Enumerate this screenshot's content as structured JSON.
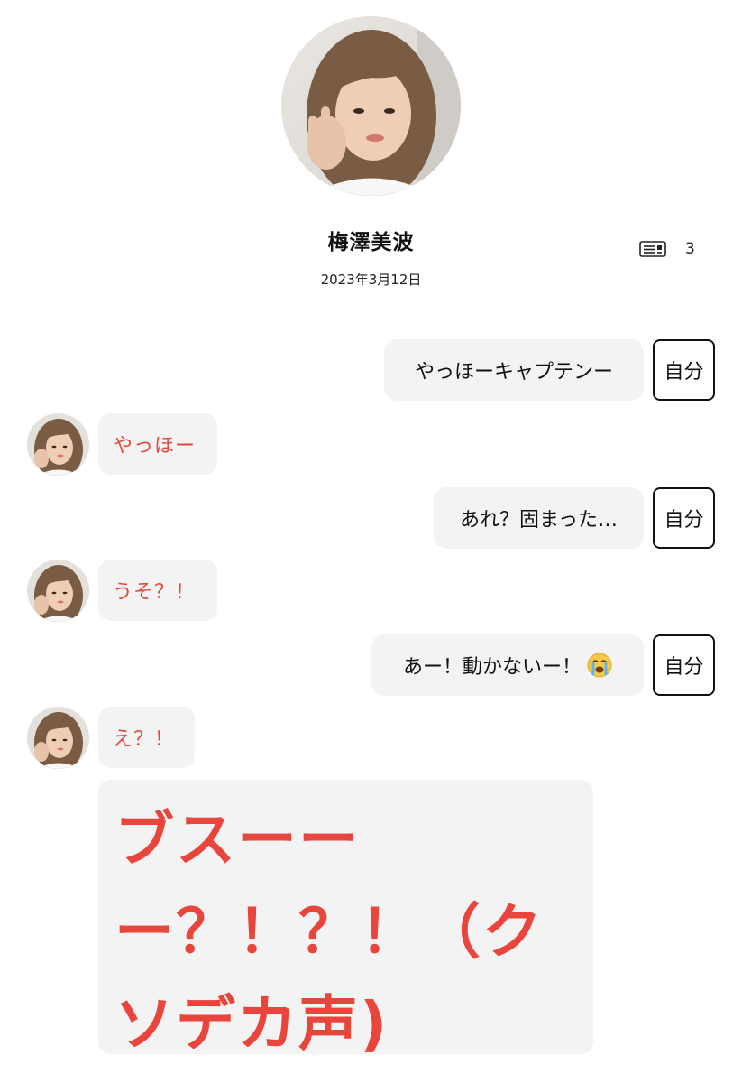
{
  "header": {
    "member_name": "梅澤美波",
    "date": "2023年3月12日",
    "letter_icon": "letter-list-icon",
    "letter_count": "3"
  },
  "messages": [
    {
      "sender": "self",
      "text": "やっほーキャプテンー",
      "tag": "自分"
    },
    {
      "sender": "member",
      "text": "やっほー"
    },
    {
      "sender": "self",
      "text": "あれ？固まった…",
      "tag": "自分"
    },
    {
      "sender": "member",
      "text": "うそ？！"
    },
    {
      "sender": "self",
      "text": "あー！動かないー！",
      "emoji": "crying-face-icon",
      "tag": "自分"
    },
    {
      "sender": "member",
      "text": "え？！"
    },
    {
      "sender": "member",
      "text_lines": [
        "ブスーー",
        "ー？！？！（ク",
        "ソデカ声)"
      ]
    }
  ],
  "colors": {
    "member_text": "#e5483f",
    "bubble_bg": "#f3f3f3",
    "self_text": "#111111"
  }
}
